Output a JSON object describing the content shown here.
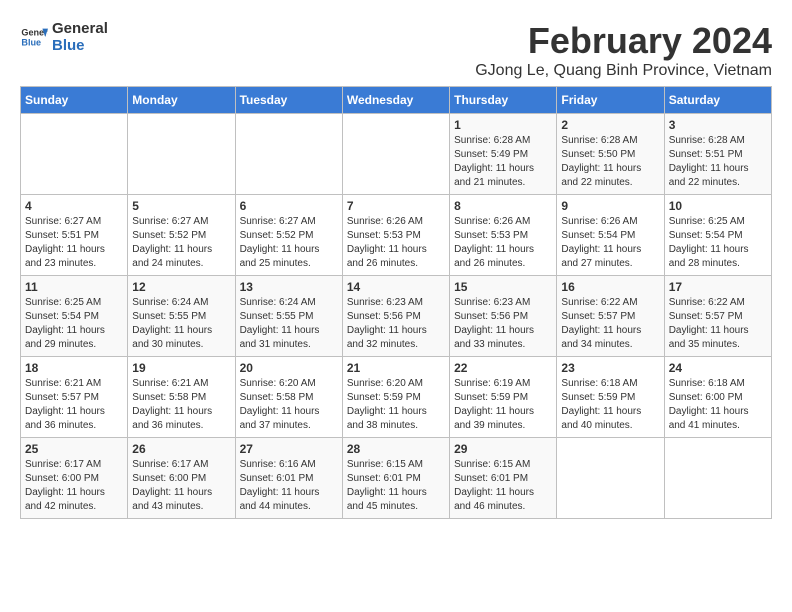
{
  "header": {
    "logo_general": "General",
    "logo_blue": "Blue",
    "month_year": "February 2024",
    "location": "GJong Le, Quang Binh Province, Vietnam"
  },
  "weekdays": [
    "Sunday",
    "Monday",
    "Tuesday",
    "Wednesday",
    "Thursday",
    "Friday",
    "Saturday"
  ],
  "weeks": [
    [
      {
        "day": "",
        "detail": ""
      },
      {
        "day": "",
        "detail": ""
      },
      {
        "day": "",
        "detail": ""
      },
      {
        "day": "",
        "detail": ""
      },
      {
        "day": "1",
        "detail": "Sunrise: 6:28 AM\nSunset: 5:49 PM\nDaylight: 11 hours\nand 21 minutes."
      },
      {
        "day": "2",
        "detail": "Sunrise: 6:28 AM\nSunset: 5:50 PM\nDaylight: 11 hours\nand 22 minutes."
      },
      {
        "day": "3",
        "detail": "Sunrise: 6:28 AM\nSunset: 5:51 PM\nDaylight: 11 hours\nand 22 minutes."
      }
    ],
    [
      {
        "day": "4",
        "detail": "Sunrise: 6:27 AM\nSunset: 5:51 PM\nDaylight: 11 hours\nand 23 minutes."
      },
      {
        "day": "5",
        "detail": "Sunrise: 6:27 AM\nSunset: 5:52 PM\nDaylight: 11 hours\nand 24 minutes."
      },
      {
        "day": "6",
        "detail": "Sunrise: 6:27 AM\nSunset: 5:52 PM\nDaylight: 11 hours\nand 25 minutes."
      },
      {
        "day": "7",
        "detail": "Sunrise: 6:26 AM\nSunset: 5:53 PM\nDaylight: 11 hours\nand 26 minutes."
      },
      {
        "day": "8",
        "detail": "Sunrise: 6:26 AM\nSunset: 5:53 PM\nDaylight: 11 hours\nand 26 minutes."
      },
      {
        "day": "9",
        "detail": "Sunrise: 6:26 AM\nSunset: 5:54 PM\nDaylight: 11 hours\nand 27 minutes."
      },
      {
        "day": "10",
        "detail": "Sunrise: 6:25 AM\nSunset: 5:54 PM\nDaylight: 11 hours\nand 28 minutes."
      }
    ],
    [
      {
        "day": "11",
        "detail": "Sunrise: 6:25 AM\nSunset: 5:54 PM\nDaylight: 11 hours\nand 29 minutes."
      },
      {
        "day": "12",
        "detail": "Sunrise: 6:24 AM\nSunset: 5:55 PM\nDaylight: 11 hours\nand 30 minutes."
      },
      {
        "day": "13",
        "detail": "Sunrise: 6:24 AM\nSunset: 5:55 PM\nDaylight: 11 hours\nand 31 minutes."
      },
      {
        "day": "14",
        "detail": "Sunrise: 6:23 AM\nSunset: 5:56 PM\nDaylight: 11 hours\nand 32 minutes."
      },
      {
        "day": "15",
        "detail": "Sunrise: 6:23 AM\nSunset: 5:56 PM\nDaylight: 11 hours\nand 33 minutes."
      },
      {
        "day": "16",
        "detail": "Sunrise: 6:22 AM\nSunset: 5:57 PM\nDaylight: 11 hours\nand 34 minutes."
      },
      {
        "day": "17",
        "detail": "Sunrise: 6:22 AM\nSunset: 5:57 PM\nDaylight: 11 hours\nand 35 minutes."
      }
    ],
    [
      {
        "day": "18",
        "detail": "Sunrise: 6:21 AM\nSunset: 5:57 PM\nDaylight: 11 hours\nand 36 minutes."
      },
      {
        "day": "19",
        "detail": "Sunrise: 6:21 AM\nSunset: 5:58 PM\nDaylight: 11 hours\nand 36 minutes."
      },
      {
        "day": "20",
        "detail": "Sunrise: 6:20 AM\nSunset: 5:58 PM\nDaylight: 11 hours\nand 37 minutes."
      },
      {
        "day": "21",
        "detail": "Sunrise: 6:20 AM\nSunset: 5:59 PM\nDaylight: 11 hours\nand 38 minutes."
      },
      {
        "day": "22",
        "detail": "Sunrise: 6:19 AM\nSunset: 5:59 PM\nDaylight: 11 hours\nand 39 minutes."
      },
      {
        "day": "23",
        "detail": "Sunrise: 6:18 AM\nSunset: 5:59 PM\nDaylight: 11 hours\nand 40 minutes."
      },
      {
        "day": "24",
        "detail": "Sunrise: 6:18 AM\nSunset: 6:00 PM\nDaylight: 11 hours\nand 41 minutes."
      }
    ],
    [
      {
        "day": "25",
        "detail": "Sunrise: 6:17 AM\nSunset: 6:00 PM\nDaylight: 11 hours\nand 42 minutes."
      },
      {
        "day": "26",
        "detail": "Sunrise: 6:17 AM\nSunset: 6:00 PM\nDaylight: 11 hours\nand 43 minutes."
      },
      {
        "day": "27",
        "detail": "Sunrise: 6:16 AM\nSunset: 6:01 PM\nDaylight: 11 hours\nand 44 minutes."
      },
      {
        "day": "28",
        "detail": "Sunrise: 6:15 AM\nSunset: 6:01 PM\nDaylight: 11 hours\nand 45 minutes."
      },
      {
        "day": "29",
        "detail": "Sunrise: 6:15 AM\nSunset: 6:01 PM\nDaylight: 11 hours\nand 46 minutes."
      },
      {
        "day": "",
        "detail": ""
      },
      {
        "day": "",
        "detail": ""
      }
    ]
  ]
}
